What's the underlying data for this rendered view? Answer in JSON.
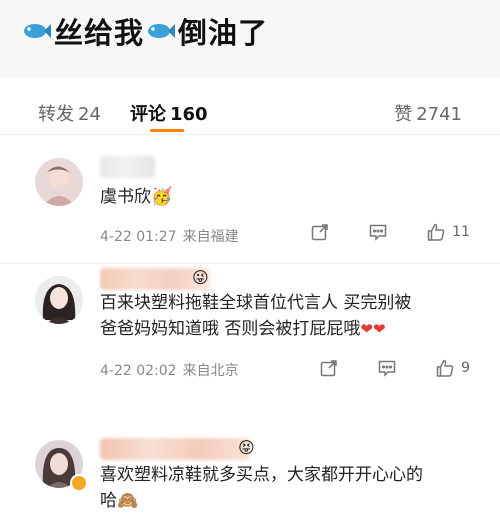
{
  "post": {
    "title_part1": "丝给我",
    "title_part2": "倒油了"
  },
  "tabs": {
    "repost_label": "转发",
    "repost_count": "24",
    "comments_label": "评论",
    "comments_count": "160",
    "likes_label": "赞",
    "likes_count": "2741"
  },
  "comments": [
    {
      "text": "虞书欣",
      "emoji": "🥳",
      "date": "4-22 01:27",
      "location": "来自福建",
      "likes": "11"
    },
    {
      "text_line1": "百来块塑料拖鞋全球首位代言人 买完别被",
      "text_line2": "爸爸妈妈知道哦 否则会被打屁屁哦",
      "hearts": "❤❤",
      "name_emoji": "😜",
      "date": "4-22 02:02",
      "location": "来自北京",
      "likes": "9"
    },
    {
      "text_line1": "喜欢塑料凉鞋就多买点，大家都开开心心的",
      "text_line2": "哈",
      "emoji": "🙈",
      "name_emoji": "😝"
    }
  ],
  "colors": {
    "accent_underline": "#ff8200",
    "heart": "#e53935",
    "verified_badge": "#f5a623"
  }
}
